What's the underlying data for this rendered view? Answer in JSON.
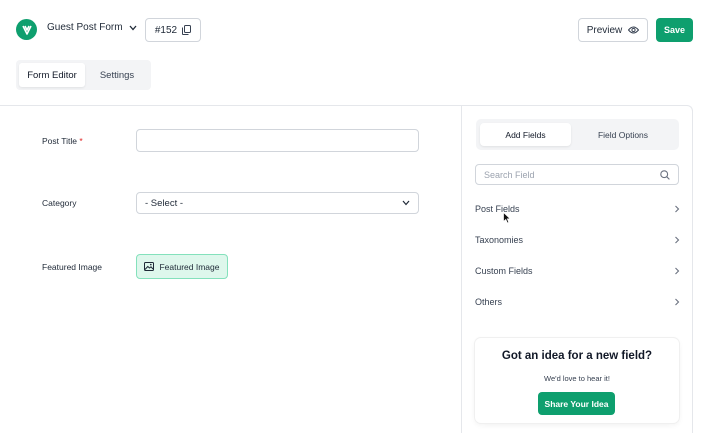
{
  "header": {
    "form_name": "Guest Post Form",
    "form_id": "#152",
    "preview_label": "Preview",
    "save_label": "Save"
  },
  "editor_tabs": [
    {
      "label": "Form Editor",
      "active": true
    },
    {
      "label": "Settings",
      "active": false
    }
  ],
  "form": {
    "fields": [
      {
        "label": "Post Title",
        "required_mark": "*",
        "type": "text",
        "value": ""
      },
      {
        "label": "Category",
        "type": "select",
        "value": "- Select -"
      },
      {
        "label": "Featured Image",
        "type": "image",
        "button_label": "Featured Image"
      }
    ]
  },
  "sidebar": {
    "tabs": [
      {
        "label": "Add Fields",
        "active": true
      },
      {
        "label": "Field Options",
        "active": false
      }
    ],
    "search_placeholder": "Search Field",
    "categories": [
      {
        "label": "Post Fields"
      },
      {
        "label": "Taxonomies"
      },
      {
        "label": "Custom Fields"
      },
      {
        "label": "Others"
      }
    ],
    "idea_card": {
      "title": "Got an idea for a new field?",
      "subtitle": "We'd love to hear it!",
      "button_label": "Share Your Idea"
    }
  },
  "colors": {
    "accent": "#0e9f6e",
    "required": "#e02424",
    "featured_bg": "#def7ec"
  }
}
